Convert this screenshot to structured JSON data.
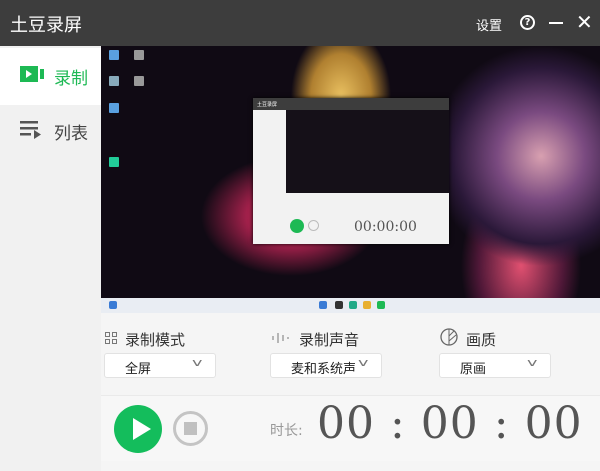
{
  "app": {
    "title": "土豆录屏"
  },
  "titlebar": {
    "settings": "设置",
    "help_icon": "?",
    "close_icon": "✕"
  },
  "sidebar": {
    "items": [
      {
        "label": "录制",
        "icon": "video-camera-icon",
        "active": true
      },
      {
        "label": "列表",
        "icon": "list-icon"
      }
    ]
  },
  "mini": {
    "title": "土豆录屏",
    "time": "00:00:00"
  },
  "settings": {
    "mode": {
      "label": "录制模式",
      "value": "全屏",
      "icon": "grid-icon"
    },
    "audio": {
      "label": "录制声音",
      "value": "麦和系统声音",
      "icon": "audio-wave-icon"
    },
    "quality": {
      "label": "画质",
      "value": "原画",
      "icon": "quality-icon"
    }
  },
  "control": {
    "duration_label": "时长:",
    "time": "00 : 00 : 00"
  },
  "colors": {
    "accent": "#14bd5c",
    "titlebar": "#3d3d3d"
  }
}
